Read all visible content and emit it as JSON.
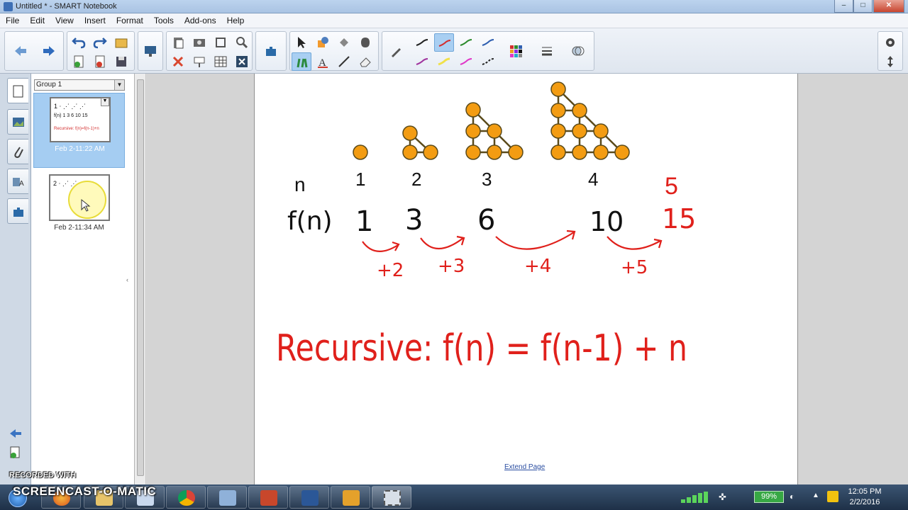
{
  "window": {
    "title": "Untitled * - SMART Notebook"
  },
  "menu": [
    "File",
    "Edit",
    "View",
    "Insert",
    "Format",
    "Tools",
    "Add-ons",
    "Help"
  ],
  "sorter": {
    "group_label": "Group 1",
    "pages": [
      {
        "date": "Feb 2-11:22 AM",
        "selected": true
      },
      {
        "date": "Feb 2-11:34 AM",
        "selected": false
      }
    ]
  },
  "canvas": {
    "n_values": [
      "1",
      "2",
      "3",
      "4"
    ],
    "n_label": "n",
    "fn_label": "f(n)",
    "fn_values": [
      "1",
      "3",
      "6",
      "10"
    ],
    "n_next": "5",
    "fn_next": "15",
    "increments": [
      "+2",
      "+3",
      "+4",
      "+5"
    ],
    "recursive_formula": "Recursive: f(n) = f(n-1) + n",
    "extend_link": "Extend Page"
  },
  "colors": {
    "dot_fill": "#f39c12",
    "dot_stroke": "#5a4a1a",
    "ink_red": "#e0201b",
    "ink_black": "#111111"
  },
  "taskbar": {
    "battery": "99%",
    "time": "12:05 PM",
    "date": "2/2/2016",
    "watermark_top": "RECORDED WITH",
    "watermark_main": "SCREENCAST-O-MATIC"
  }
}
